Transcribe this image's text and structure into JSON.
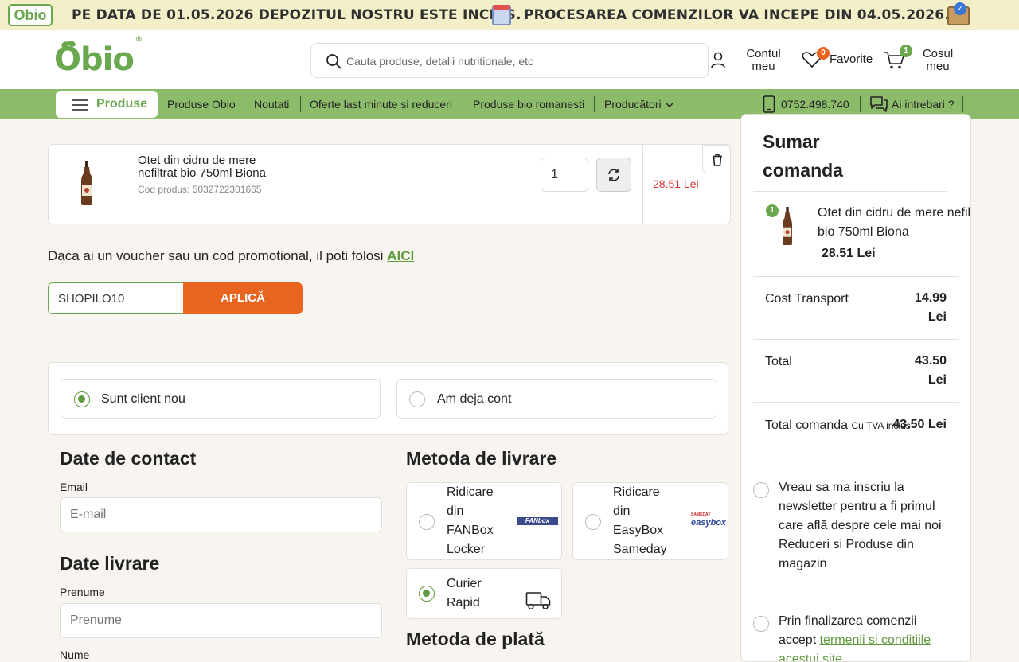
{
  "banner": {
    "logo": "Obio",
    "left_text": "PE DATA DE 01.05.2026 DEPOZITUL NOSTRU ESTE INCHIS.",
    "right_text": "PROCESAREA COMENZILOR VA INCEPE DIN 04.05.2026."
  },
  "header": {
    "logo": "Obio",
    "search_placeholder": "Cauta produse, detalii nutritionale, etc",
    "account_line1": "Contul",
    "account_line2": "meu",
    "favorites_label": "Favorite",
    "favorites_count": "0",
    "cart_line1": "Cosul",
    "cart_line2": "meu",
    "cart_count": "1"
  },
  "nav": {
    "produse": "Produse",
    "items": [
      "Produse Obio",
      "Noutati",
      "Oferte last minute si reduceri",
      "Produse bio romanesti",
      "Producători"
    ],
    "phone": "0752.498.740",
    "questions": "Ai intrebari ?"
  },
  "cart": {
    "product_name": "Otet din cidru de mere nefiltrat bio 750ml Biona",
    "product_code": "Cod produs: 5032722301665",
    "quantity": "1",
    "price": "28.51 Lei"
  },
  "voucher": {
    "text": "Daca ai un voucher sau un cod promotional, il poti folosi",
    "link": "AICI",
    "code": "SHOPILO10",
    "button": "APLICĂ"
  },
  "client": {
    "new": "Sunt client nou",
    "existing": "Am deja cont",
    "selected": "new"
  },
  "contact": {
    "title": "Date de contact",
    "email_label": "Email",
    "email_placeholder": "E-mail"
  },
  "delivery": {
    "title": "Date livrare",
    "first_name_label": "Prenume",
    "first_name_placeholder": "Prenume",
    "last_name_label": "Nume"
  },
  "shipping": {
    "title": "Metoda de livrare",
    "options": [
      {
        "label_lines": [
          "Ridicare",
          "din",
          "FANBox",
          "Locker"
        ],
        "logo": "FANbox"
      },
      {
        "label_lines": [
          "Ridicare",
          "din",
          "EasyBox",
          "Sameday"
        ],
        "logo_top": "SAMEDAY",
        "logo": "easybox"
      },
      {
        "label_lines": [
          "Curier",
          "Rapid"
        ]
      }
    ],
    "selected": "Curier Rapid"
  },
  "payment": {
    "title": "Metoda de plată"
  },
  "summary": {
    "title_line1": "Sumar",
    "title_line2": "comanda",
    "item_count": "1",
    "item_name_line1": "Otet din cidru de mere nefiltrat",
    "item_name_line2": "bio 750ml Biona",
    "item_price": "28.51 Lei",
    "transport_label": "Cost Transport",
    "transport_value_line1": "14.99",
    "transport_value_line2": "Lei",
    "total_label": "Total",
    "total_value_line1": "43.50",
    "total_value_line2": "Lei",
    "order_total_label": "Total comanda",
    "order_total_vat": "Cu TVA inclus",
    "order_total_value": "43.50 Lei",
    "newsletter_lines": [
      "Vreau sa ma inscriu la",
      "newsletter pentru a fi primul",
      "care află despre cele mai noi",
      "Reduceri si Produse din",
      "magazin"
    ],
    "terms_line1": "Prin finalizarea comenzii",
    "terms_prefix": "accept",
    "terms_link_line1": "termenii si conditiile",
    "terms_link_line2": "acestui site"
  },
  "colors": {
    "brand_green": "#6aa84f",
    "nav_green": "#8cbc6a",
    "apply_orange": "#e8641f",
    "price_red": "#dd3333"
  }
}
